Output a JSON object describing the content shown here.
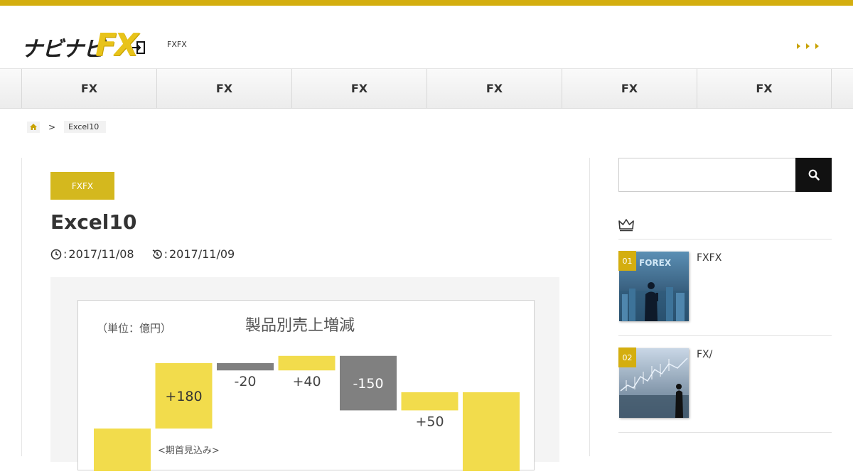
{
  "header": {
    "logo_kana": "ナビナビ",
    "logo_fx": "FX",
    "tagline": "FXFX"
  },
  "nav": {
    "items": [
      "FX",
      "FX",
      "FX",
      "FX",
      "FX",
      "FX"
    ]
  },
  "breadcrumb": {
    "separator": ">",
    "current": "Excel10"
  },
  "article": {
    "category": "FXFX",
    "title": "Excel10",
    "published_prefix": ": ",
    "published": "2017/11/08",
    "updated_prefix": ": ",
    "updated": "2017/11/09"
  },
  "chart_data": {
    "type": "bar",
    "title": "製品別売上増減",
    "unit_label": "（単位：億円）",
    "categories": [
      "",
      "",
      "",
      "",
      "",
      "",
      ""
    ],
    "values": [
      null,
      180,
      -20,
      40,
      -150,
      50,
      null
    ],
    "data_labels": [
      "",
      "+180",
      "-20",
      "+40",
      "-150",
      "+50",
      ""
    ],
    "colors": {
      "increase": "#f2dc4c",
      "decrease": "#808080"
    },
    "partial_label": "<期首見込み>"
  },
  "sidebar": {
    "ranking": [
      {
        "rank": "01",
        "title": "FXFX",
        "thumb_text": "FOREX"
      },
      {
        "rank": "02",
        "title": "FX/"
      }
    ]
  },
  "colors": {
    "accent": "#d4ae0f",
    "badge": "#d4b81e"
  }
}
